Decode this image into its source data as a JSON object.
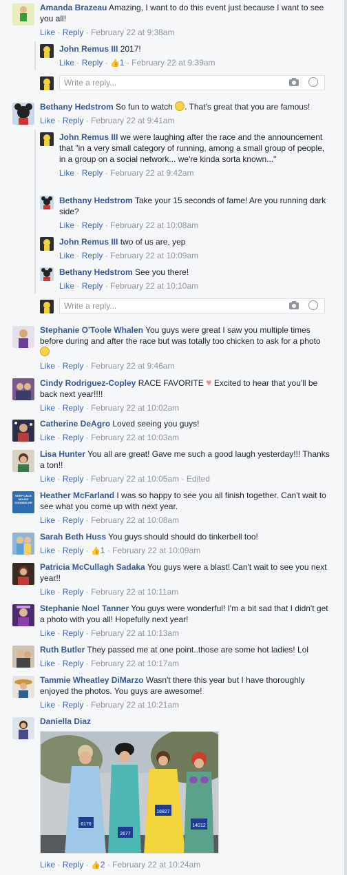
{
  "ui": {
    "like": "Like",
    "reply": "Reply",
    "sep": "·",
    "reply_placeholder": "Write a reply..."
  },
  "comments": [
    {
      "name": "Amanda Brazeau",
      "text": "Amazing, I want to do this event just because I want to see you all!",
      "time": "February 22 at 9:38am"
    },
    {
      "name": "John Remus III",
      "text": "2017!",
      "likes": "1",
      "time": "February 22 at 9:39am"
    },
    {
      "name": "Bethany Hedstrom",
      "text": "So fun to watch",
      "text2": ". That's great that you are famous!",
      "time": "February 22 at 9:41am"
    },
    {
      "name": "John Remus III",
      "text": "we were laughing after the race and the announcement that \"in a very small category of running, among a small group of people, in a group on a social network... we're kinda sorta known...\"",
      "time": "February 22 at 9:42am"
    },
    {
      "name": "Bethany Hedstrom",
      "text": "Take your 15 seconds of fame! Are you running dark side?",
      "time": "February 22 at 10:08am"
    },
    {
      "name": "John Remus III",
      "text": "two of us are, yep",
      "time": "February 22 at 10:09am"
    },
    {
      "name": "Bethany Hedstrom",
      "text": "See you there!",
      "time": "February 22 at 10:10am"
    },
    {
      "name": "Stephanie O'Toole Whalen",
      "text": "You guys were great I saw you multiple times before during and after the race but was totally too chicken to ask for a photo",
      "time": "February 22 at 9:46am"
    },
    {
      "name": "Cindy Rodriguez-Copley",
      "text": "RACE FAVORITE",
      "text2": "Excited to hear that you'll be back next year!!!!",
      "time": "February 22 at 10:02am"
    },
    {
      "name": "Catherine DeAgro",
      "text": "Loved seeing you guys!",
      "time": "February 22 at 10:03am"
    },
    {
      "name": "Lisa Hunter",
      "text": "You all are great! Gave me such a good laugh yesterday!!! Thanks a ton!!",
      "time": "February 22 at 10:05am",
      "edited": "Edited"
    },
    {
      "name": "Heather McFarland",
      "text": "I was so happy to see you all finish together. Can't wait to see what you come up with next year.",
      "time": "February 22 at 10:08am",
      "avatar_text": "KEEP CALM MOUSE COUNSELOR"
    },
    {
      "name": "Sarah Beth Huss",
      "text": "You guys should should do tinkerbell too!",
      "likes": "1",
      "time": "February 22 at 10:09am"
    },
    {
      "name": "Patricia McCullagh Sadaka",
      "text": "You guys were a blast! Can't wait to see you next year!!",
      "time": "February 22 at 10:11am"
    },
    {
      "name": "Stephanie Noel Tanner",
      "text": "You guys were wonderful! I'm a bit sad that I didn't get a photo with you all! Hopefully next year!",
      "time": "February 22 at 10:13am"
    },
    {
      "name": "Ruth Butler",
      "text": "They passed me at one point..those are some hot ladies! Lol",
      "time": "February 22 at 10:17am"
    },
    {
      "name": "Tammie Wheatley DiMarzo",
      "text": "Wasn't there this year but I have thoroughly enjoyed the photos. You guys are awesome!",
      "time": "February 22 at 10:21am"
    },
    {
      "name": "Daniella Diaz",
      "text": "",
      "likes": "2",
      "time": "February 22 at 10:24am",
      "bibs": [
        "6176",
        "2677",
        "16827",
        "14012"
      ]
    }
  ],
  "colors": {
    "link": "#365899",
    "action": "#4267b2",
    "meta": "#90949c",
    "line": "#dddfe2"
  }
}
